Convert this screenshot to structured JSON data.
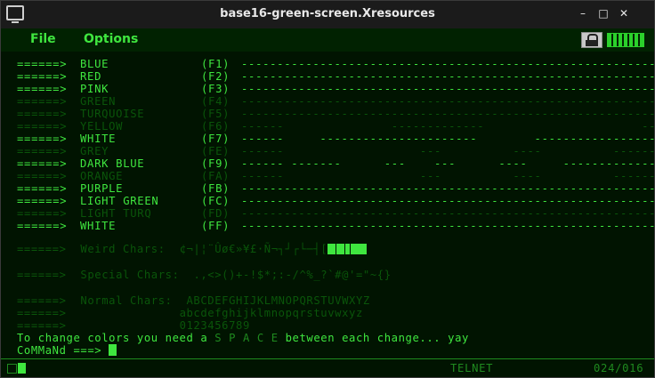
{
  "window": {
    "title": "base16-green-screen.Xresources"
  },
  "menu": {
    "file": "File",
    "options": "Options"
  },
  "window_buttons": {
    "min": "–",
    "max": "□",
    "close": "✕"
  },
  "color_rows": [
    {
      "arrow": "======>",
      "name": "BLUE",
      "fkey": "(F1)",
      "pattern": "------------------------------------------------------------",
      "style": "bright"
    },
    {
      "arrow": "======>",
      "name": "RED",
      "fkey": "(F2)",
      "pattern": "------------------------------------------------------------",
      "style": "bright"
    },
    {
      "arrow": "======>",
      "name": "PINK",
      "fkey": "(F3)",
      "pattern": "------------------------------------------------------------",
      "style": "bright"
    },
    {
      "arrow": "======>",
      "name": "GREEN",
      "fkey": "(F4)",
      "pattern": "------------------------------------------------------------",
      "style": "dim"
    },
    {
      "arrow": "======>",
      "name": "TURQUOISE",
      "fkey": "(F5)",
      "pattern": "------------------------------------------------------------",
      "style": "dim"
    },
    {
      "arrow": "======>",
      "name": "YELLOW",
      "fkey": "(F6)",
      "pattern": "------               -------------                      ----",
      "style": "dim"
    },
    {
      "arrow": "======>",
      "name": "WHITE",
      "fkey": "(F7)",
      "pattern": "------     ----------------------        -------------------",
      "style": "bright"
    },
    {
      "arrow": "======>",
      "name": "GREY",
      "fkey": "(FE)",
      "pattern": "------                   ---          ----          --------",
      "style": "dim"
    },
    {
      "arrow": "======>",
      "name": "DARK BLUE",
      "fkey": "(F9)",
      "pattern": "------ -------      ---    ---      ----     --------------",
      "style": "bright"
    },
    {
      "arrow": "======>",
      "name": "ORANGE",
      "fkey": "(FA)",
      "pattern": "------                   ---          ----          --------",
      "style": "dim"
    },
    {
      "arrow": "======>",
      "name": "PURPLE",
      "fkey": "(FB)",
      "pattern": "------------------------------------------------------------",
      "style": "bright"
    },
    {
      "arrow": "======>",
      "name": "LIGHT GREEN",
      "fkey": "(FC)",
      "pattern": "------------------------------------------------------------",
      "style": "bright"
    },
    {
      "arrow": "======>",
      "name": "LIGHT TURQ",
      "fkey": "(FD)",
      "pattern": "------------------------------------------------------------",
      "style": "dim"
    },
    {
      "arrow": "======>",
      "name": "WHITE",
      "fkey": "(FF)",
      "pattern": "------------------------------------------------------------",
      "style": "bright"
    }
  ],
  "weird": {
    "label": "======>  Weird Chars:",
    "chars": "¢¬|¦¨Ûø€»¥£·Ñ¬┐┘┌└─┤["
  },
  "special": {
    "label": "======>  Special Chars:",
    "chars": ".,<>()+-!$*;:-/^%_?`#@'=\"~{}"
  },
  "normal": {
    "label": "======>  Normal Chars:",
    "arrow2": "======>",
    "arrow3": "======>",
    "upper": "ABCDEFGHIJKLMNOPQRSTUVWXYZ",
    "lower": "abcdefghijklmnopqrstuvwxyz",
    "digits": "0123456789"
  },
  "message": {
    "before": "To change colors you need a ",
    "space": "S P A C E",
    "after": " between each change... yay"
  },
  "command": {
    "prompt": "CoMMaNd ===>"
  },
  "status": {
    "mode": "TELNET",
    "position": "024/016"
  },
  "colors": {
    "bright": "#3fe63f",
    "dim": "#0a550a",
    "background": "#011401",
    "titlebar": "#1b1b1b"
  }
}
